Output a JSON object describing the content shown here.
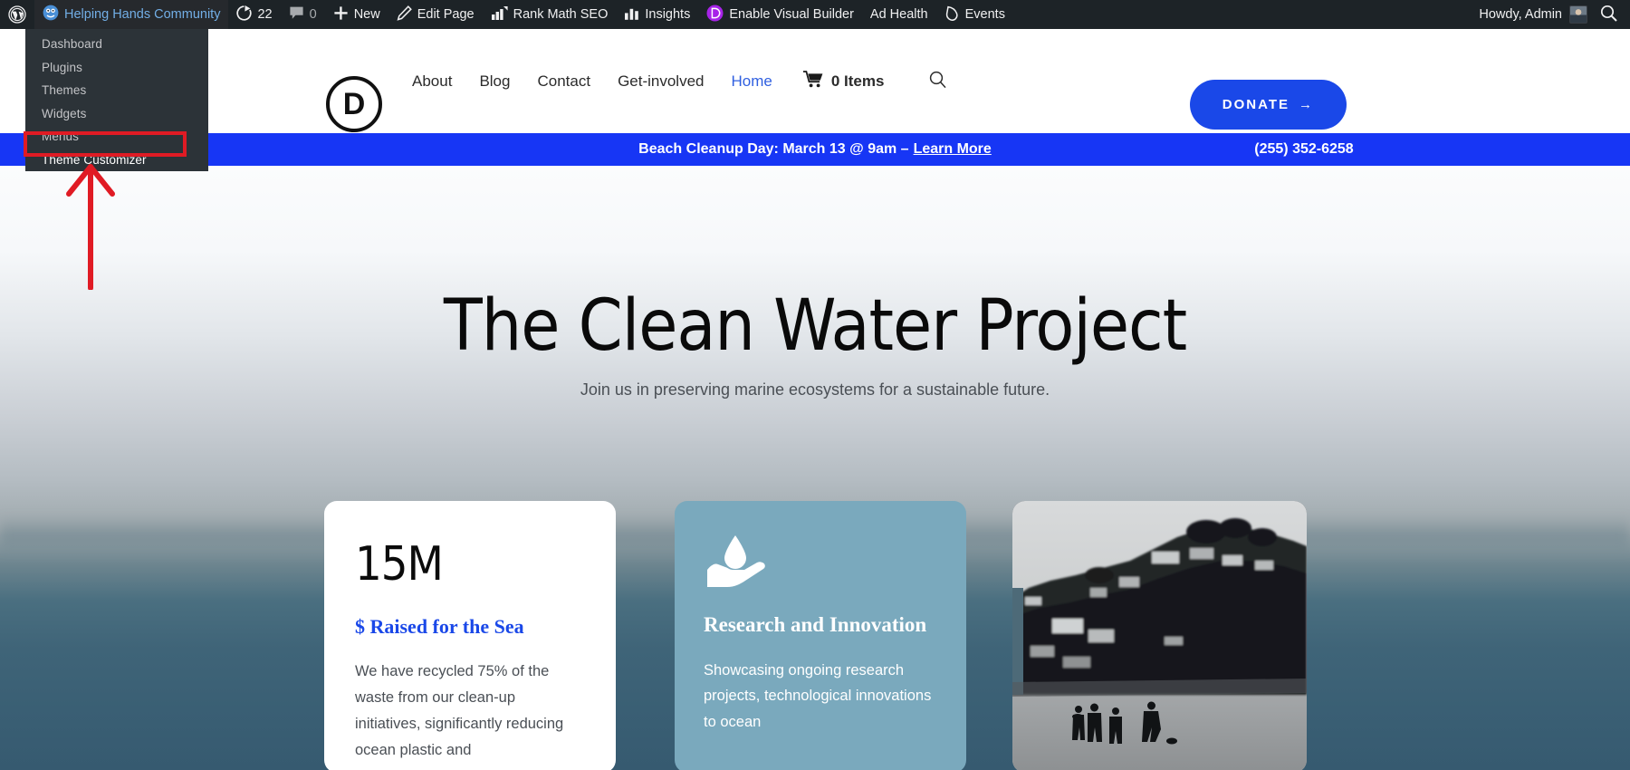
{
  "admin_bar": {
    "items": [
      {
        "name": "wp-logo",
        "label": "",
        "icon": "wordpress-icon"
      },
      {
        "name": "sitename",
        "label": "Helping Hands Community",
        "icon": "site-icon"
      },
      {
        "name": "updates",
        "label": "22",
        "icon": "updates-icon"
      },
      {
        "name": "comments",
        "label": "0",
        "icon": "comment-icon"
      },
      {
        "name": "new-content",
        "label": "New",
        "icon": "plus-icon"
      },
      {
        "name": "edit-page",
        "label": "Edit Page",
        "icon": "pencil-icon"
      },
      {
        "name": "rank-math",
        "label": "Rank Math SEO",
        "icon": "rankmath-icon"
      },
      {
        "name": "insights",
        "label": "Insights",
        "icon": "bar-chart-icon"
      },
      {
        "name": "visual-builder",
        "label": "Enable Visual Builder",
        "icon": "divi-icon"
      },
      {
        "name": "ad-health",
        "label": "Ad Health",
        "icon": ""
      },
      {
        "name": "events",
        "label": "Events",
        "icon": "events-icon"
      }
    ],
    "howdy": "Howdy, Admin",
    "search_icon": "search-icon"
  },
  "admin_dropdown": {
    "items": [
      {
        "label": "Dashboard",
        "highlighted": false
      },
      {
        "label": "Plugins",
        "highlighted": false
      },
      {
        "label": "Themes",
        "highlighted": false
      },
      {
        "label": "Widgets",
        "highlighted": false
      },
      {
        "label": "Menus",
        "highlighted": false
      },
      {
        "label": "Theme Customizer",
        "highlighted": true
      }
    ],
    "highlight_color": "#e01b24"
  },
  "site_header": {
    "logo": "D",
    "nav": [
      {
        "label": "About",
        "active": false
      },
      {
        "label": "Blog",
        "active": false
      },
      {
        "label": "Contact",
        "active": false
      },
      {
        "label": "Get-involved",
        "active": false
      },
      {
        "label": "Home",
        "active": true
      }
    ],
    "cart_icon": "shopping-cart-icon",
    "cart_count": "0 Items",
    "search_icon": "search-icon",
    "donate_label": "DONATE",
    "donate_arrow": "→",
    "donate_color": "#1a48e8"
  },
  "announcement": {
    "text": "Beach Cleanup Day: March 13 @ 9am – ",
    "link": "Learn More",
    "phone": "(255) 352-6258",
    "background": "#1736f5"
  },
  "hero": {
    "title": "The Clean Water Project",
    "subtitle": "Join us in preserving marine ecosystems for a sustainable future."
  },
  "cards": {
    "stat": {
      "number": "15M",
      "label": "$ Raised for the Sea",
      "body": "We have recycled 75% of the waste from our clean-up initiatives, significantly reducing ocean plastic and",
      "label_color": "#1a48e8"
    },
    "research": {
      "icon": "water-drop-hand-icon",
      "title": "Research and Innovation",
      "body": "Showcasing ongoing research projects, technological innovations to ocean",
      "background": "#7aa9bd"
    },
    "photo": {
      "alt": "beach-hillside-photo"
    }
  }
}
